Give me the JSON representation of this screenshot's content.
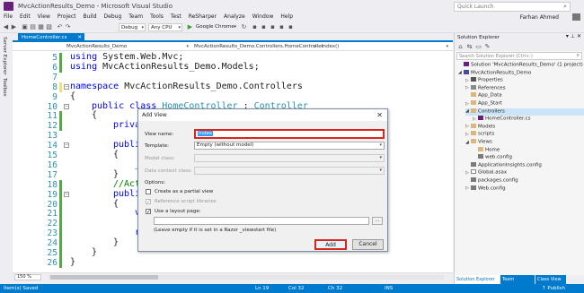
{
  "window": {
    "title": "MvcActionResults_Demo - Microsoft Visual Studio",
    "quick_launch_placeholder": "Quick Launch",
    "user_name": "Farhan Ahmed"
  },
  "menu": [
    "File",
    "Edit",
    "View",
    "Project",
    "Build",
    "Debug",
    "Team",
    "Tools",
    "Test",
    "ReSharper",
    "Analyze",
    "Window",
    "Help"
  ],
  "toolbar": {
    "config": "Debug",
    "platform": "Any CPU",
    "run_target": "Google Chrome"
  },
  "left_strip": {
    "server_explorer": "Server Explorer",
    "toolbox": "Toolbox"
  },
  "editor": {
    "active_tab": "HomeController.cs",
    "nav_project": "MvcActionResults_Demo",
    "nav_class": "MvcActionResults_Demo.Controllers.HomeController",
    "nav_member": "Index()",
    "zoom": "150 %",
    "lines": [
      {
        "n": "5",
        "indent": 0,
        "parts": [
          {
            "t": "using ",
            "c": "kw"
          },
          {
            "t": "System.Web.Mvc;",
            "c": ""
          }
        ]
      },
      {
        "n": "6",
        "indent": 0,
        "parts": [
          {
            "t": "using ",
            "c": "kw"
          },
          {
            "t": "MvcActionResults_Demo.Models;",
            "c": ""
          }
        ]
      },
      {
        "n": "7",
        "indent": 0,
        "parts": []
      },
      {
        "n": "8",
        "indent": 0,
        "parts": [
          {
            "t": "namespace ",
            "c": "kw"
          },
          {
            "t": "MvcActionResults_Demo.Controllers",
            "c": ""
          }
        ]
      },
      {
        "n": "9",
        "indent": 0,
        "parts": [
          {
            "t": "{",
            "c": ""
          }
        ]
      },
      {
        "n": "10",
        "indent": 1,
        "parts": [
          {
            "t": "public ",
            "c": "kw"
          },
          {
            "t": "class ",
            "c": "kw"
          },
          {
            "t": "HomeController",
            "c": "ty"
          },
          {
            "t": " : ",
            "c": ""
          },
          {
            "t": "Controller",
            "c": "ty"
          }
        ]
      },
      {
        "n": "11",
        "indent": 1,
        "parts": [
          {
            "t": "{",
            "c": ""
          }
        ]
      },
      {
        "n": "12",
        "indent": 2,
        "parts": [
          {
            "t": "privat",
            "c": "kw"
          }
        ]
      },
      {
        "n": "13",
        "indent": 0,
        "parts": []
      },
      {
        "n": "14",
        "indent": 2,
        "parts": [
          {
            "t": "public",
            "c": "kw"
          }
        ]
      },
      {
        "n": "15",
        "indent": 2,
        "parts": [
          {
            "t": "{",
            "c": ""
          }
        ]
      },
      {
        "n": "16",
        "indent": 3,
        "parts": [
          {
            "t": "_db",
            "c": ""
          }
        ]
      },
      {
        "n": "17",
        "indent": 2,
        "parts": [
          {
            "t": "}",
            "c": ""
          }
        ]
      },
      {
        "n": "18",
        "indent": 2,
        "parts": [
          {
            "t": "//Acti",
            "c": "cm"
          }
        ]
      },
      {
        "n": "19",
        "indent": 2,
        "parts": [
          {
            "t": "public",
            "c": "kw"
          }
        ]
      },
      {
        "n": "20",
        "indent": 2,
        "parts": [
          {
            "t": "{",
            "c": ""
          }
        ]
      },
      {
        "n": "21",
        "indent": 3,
        "parts": [
          {
            "t": "var",
            "c": "kw"
          }
        ]
      },
      {
        "n": "22",
        "indent": 0,
        "parts": []
      },
      {
        "n": "23",
        "indent": 3,
        "parts": [
          {
            "t": "ret",
            "c": "kw"
          }
        ]
      },
      {
        "n": "24",
        "indent": 2,
        "parts": [
          {
            "t": "}",
            "c": ""
          }
        ]
      },
      {
        "n": "25",
        "indent": 1,
        "parts": [
          {
            "t": "}",
            "c": ""
          }
        ]
      },
      {
        "n": "26",
        "indent": 0,
        "parts": [
          {
            "t": "}",
            "c": ""
          }
        ]
      }
    ]
  },
  "status_bar": {
    "message": "Item(s) Saved",
    "ln": "Ln 19",
    "col": "Col 32",
    "ch": "Ch 32",
    "mode": "INS",
    "publish": "↑ Publish"
  },
  "solution_explorer": {
    "title": "Solution Explorer",
    "search_placeholder": "Search Solution Explorer (Ctrl+;)",
    "nodes": [
      {
        "label": "Solution 'MvcActionResults_Demo' (1 project)",
        "depth": 0,
        "arrow": "",
        "icon": "ic-sol",
        "icon_name": "solution-icon"
      },
      {
        "label": "MvcActionResults_Demo",
        "depth": 0,
        "arrow": "◢",
        "icon": "ic-proj",
        "icon_name": "project-icon"
      },
      {
        "label": "Properties",
        "depth": 1,
        "arrow": "▷",
        "icon": "ic-prop",
        "icon_name": "wrench-icon"
      },
      {
        "label": "References",
        "depth": 1,
        "arrow": "▷",
        "icon": "ic-ref",
        "icon_name": "references-icon"
      },
      {
        "label": "App_Data",
        "depth": 1,
        "arrow": "",
        "icon": "ic-folder",
        "icon_name": "folder-icon"
      },
      {
        "label": "App_Start",
        "depth": 1,
        "arrow": "▷",
        "icon": "ic-folder",
        "icon_name": "folder-icon"
      },
      {
        "label": "Controllers",
        "depth": 1,
        "arrow": "◢",
        "icon": "ic-folder",
        "icon_name": "folder-icon"
      },
      {
        "label": "HomeController.cs",
        "depth": 2,
        "arrow": "▷",
        "icon": "ic-cs",
        "icon_name": "csharp-file-icon"
      },
      {
        "label": "Models",
        "depth": 1,
        "arrow": "▷",
        "icon": "ic-folder",
        "icon_name": "folder-icon"
      },
      {
        "label": "scripts",
        "depth": 1,
        "arrow": "▷",
        "icon": "ic-folder",
        "icon_name": "folder-icon"
      },
      {
        "label": "Views",
        "depth": 1,
        "arrow": "◢",
        "icon": "ic-folder",
        "icon_name": "folder-icon"
      },
      {
        "label": "Home",
        "depth": 2,
        "arrow": "",
        "icon": "ic-folder",
        "icon_name": "folder-icon"
      },
      {
        "label": "web.config",
        "depth": 2,
        "arrow": "",
        "icon": "ic-cfg",
        "icon_name": "config-file-icon"
      },
      {
        "label": "ApplicationInsights.config",
        "depth": 1,
        "arrow": "",
        "icon": "ic-cfg",
        "icon_name": "config-file-icon"
      },
      {
        "label": "Global.asax",
        "depth": 1,
        "arrow": "▷",
        "icon": "ic-file",
        "icon_name": "asax-file-icon"
      },
      {
        "label": "packages.config",
        "depth": 1,
        "arrow": "",
        "icon": "ic-cfg",
        "icon_name": "config-file-icon"
      },
      {
        "label": "Web.config",
        "depth": 1,
        "arrow": "▷",
        "icon": "ic-cfg",
        "icon_name": "config-file-icon"
      }
    ],
    "selected_index": 6,
    "tabs": [
      "Solution Explorer",
      "Team Explorer",
      "Class View"
    ]
  },
  "dialog": {
    "title": "Add View",
    "view_name_label": "View name:",
    "view_name_value": "Index",
    "template_label": "Template:",
    "template_value": "Empty (without model)",
    "model_class_label": "Model class:",
    "data_context_label": "Data context class:",
    "options_label": "Options:",
    "partial_view_label": "Create as a partial view",
    "reference_scripts_label": "Reference script libraries",
    "use_layout_label": "Use a layout page:",
    "layout_hint": "(Leave empty if it is set in a Razor _viewstart file)",
    "browse_label": "...",
    "add_label": "Add",
    "cancel_label": "Cancel"
  },
  "colors": {
    "accent": "#007acc",
    "highlight_red": "#d9261c",
    "keyword": "#0000ff",
    "type": "#2b91af"
  }
}
